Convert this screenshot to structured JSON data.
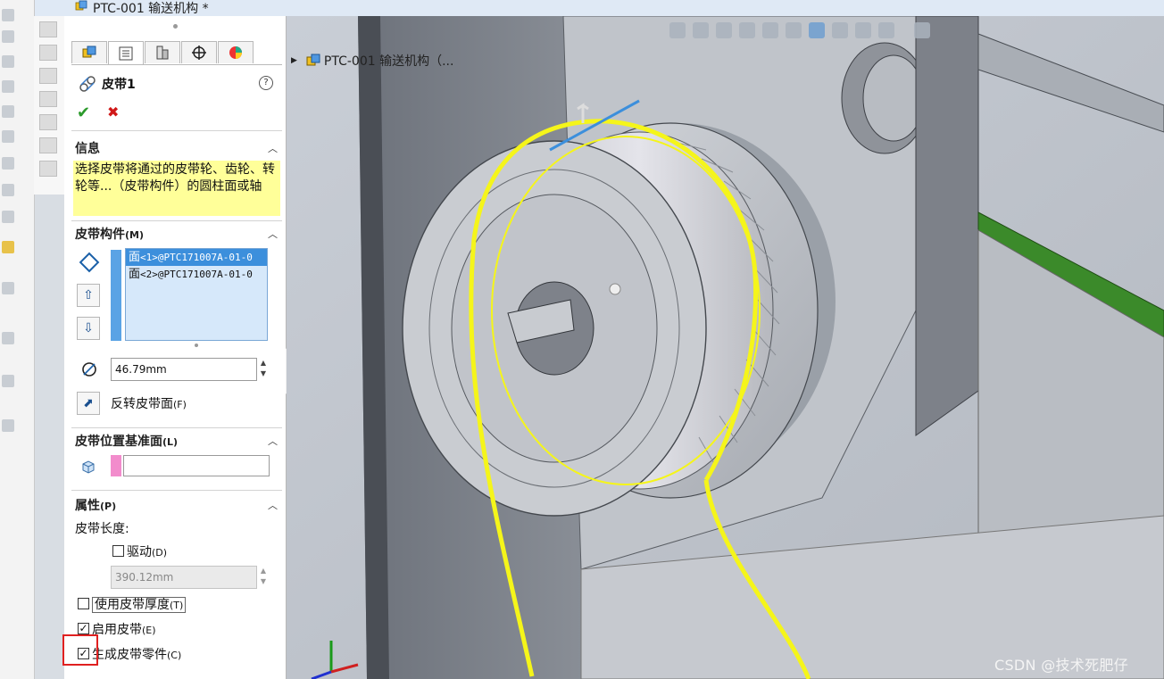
{
  "window": {
    "title": "PTC-001 输送机构 *"
  },
  "feature_tabs": [
    "feature-manager-tab",
    "property-manager-tab",
    "configuration-manager-tab",
    "dimxpert-tab",
    "display-manager-tab"
  ],
  "property_manager": {
    "title": "皮带1",
    "help": "?",
    "ok": "✔",
    "cancel": "✖",
    "info": {
      "header": "信息",
      "text": "选择皮带将通过的皮带轮、齿轮、转轮等...（皮带构件）的圆柱面或轴"
    },
    "belt_members": {
      "header": "皮带构件",
      "header_key": "(M)",
      "items": [
        {
          "prefix": "面",
          "ref": "<1>@PTC171007A-01-0"
        },
        {
          "prefix": "面",
          "ref": "<2>@PTC171007A-01-0"
        }
      ],
      "diameter": "46.79mm",
      "flip_label": "反转皮带面",
      "flip_key": "(F)"
    },
    "belt_plane": {
      "header": "皮带位置基准面",
      "header_key": "(L)",
      "value": ""
    },
    "properties": {
      "header": "属性",
      "header_key": "(P)",
      "length_label": "皮带长度:",
      "drive_label": "驱动",
      "drive_key": "(D)",
      "drive_checked": false,
      "length_value": "390.12mm",
      "use_thickness_label": "使用皮带厚度",
      "use_thickness_key": "(T)",
      "use_thickness_checked": false,
      "enable_belt_label": "启用皮带",
      "enable_belt_key": "(E)",
      "enable_belt_checked": true,
      "create_part_label": "生成皮带零件",
      "create_part_key": "(C)",
      "create_part_checked": true
    }
  },
  "feature_tree": {
    "root_label": "PTC-001 输送机构（..."
  },
  "watermark": "CSDN @技术死肥仔",
  "colors": {
    "belt_highlight": "#f5f51a",
    "selection_blue": "#3c8fdc",
    "info_yellow": "#ffff99",
    "accent_red": "#e02020"
  }
}
